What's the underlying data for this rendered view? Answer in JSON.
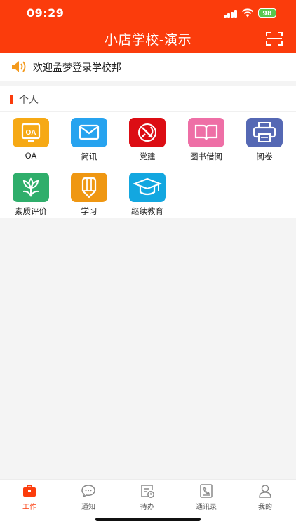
{
  "status": {
    "time": "09:29",
    "battery": "98"
  },
  "header": {
    "title": "小店学校-演示"
  },
  "notice": {
    "text": "欢迎孟梦登录学校邦"
  },
  "section": {
    "title": "个人"
  },
  "apps": [
    {
      "label": "OA",
      "icon": "oa-icon",
      "color": "#f6a915"
    },
    {
      "label": "简讯",
      "icon": "mail-icon",
      "color": "#27a3ef"
    },
    {
      "label": "党建",
      "icon": "party-emblem-icon",
      "color": "#dc0d14"
    },
    {
      "label": "图书借阅",
      "icon": "book-icon",
      "color": "#ee6fa6"
    },
    {
      "label": "阅卷",
      "icon": "printer-icon",
      "color": "#5568b4"
    },
    {
      "label": "素质评价",
      "icon": "flower-icon",
      "color": "#2fae6b"
    },
    {
      "label": "学习",
      "icon": "pencil-icon",
      "color": "#ef9712"
    },
    {
      "label": "继续教育",
      "icon": "graduation-cap-icon",
      "color": "#13a7e0"
    }
  ],
  "tabs": [
    {
      "label": "工作",
      "icon": "briefcase-icon",
      "active": true
    },
    {
      "label": "通知",
      "icon": "chat-bubble-icon",
      "active": false
    },
    {
      "label": "待办",
      "icon": "todo-clock-icon",
      "active": false
    },
    {
      "label": "通讯录",
      "icon": "contacts-icon",
      "active": false
    },
    {
      "label": "我的",
      "icon": "person-icon",
      "active": false
    }
  ],
  "colors": {
    "brand": "#fb3c0c",
    "background": "#f4f4f4"
  }
}
